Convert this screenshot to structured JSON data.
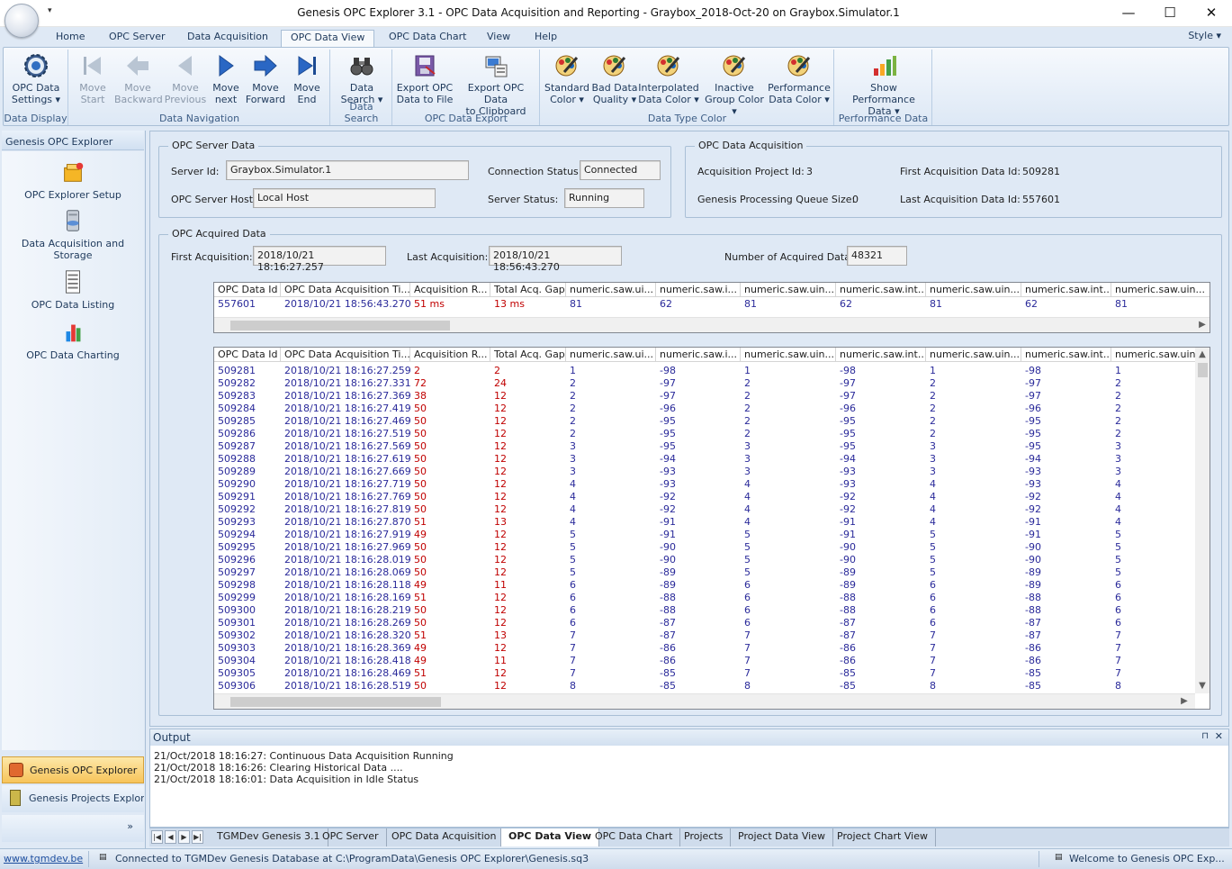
{
  "window": {
    "title": "Genesis OPC Explorer 3.1 - OPC Data Acquisition and Reporting - Graybox_2018-Oct-20 on Graybox.Simulator.1",
    "minimize": "—",
    "maximize": "☐",
    "close": "✕"
  },
  "ribbon_tabs": [
    "Home",
    "OPC Server",
    "Data Acquisition",
    "OPC Data View",
    "OPC Data Chart",
    "View",
    "Help"
  ],
  "active_tab": "OPC Data View",
  "style_menu": "Style",
  "ribbon": {
    "groups": {
      "data_display": "Data Display",
      "data_navigation": "Data Navigation",
      "data_search": "Data Search",
      "opc_data_export": "OPC Data Export",
      "data_type_color": "Data Type Color",
      "performance_data": "Performance Data"
    },
    "buttons": {
      "opc_data_settings": [
        "OPC Data",
        "Settings ▾"
      ],
      "move_start": [
        "Move",
        "Start"
      ],
      "move_backward": [
        "Move",
        "Backward"
      ],
      "move_previous": [
        "Move",
        "Previous"
      ],
      "move_next": [
        "Move",
        "next"
      ],
      "move_forward": [
        "Move",
        "Forward"
      ],
      "move_end": [
        "Move",
        "End"
      ],
      "data_search": [
        "Data",
        "Search ▾"
      ],
      "export_file": [
        "Export OPC",
        "Data to File"
      ],
      "export_clipboard": [
        "Export OPC Data",
        "to Clipboard"
      ],
      "standard_color": [
        "Standard",
        "Color ▾"
      ],
      "bad_data_quality": [
        "Bad Data",
        "Quality ▾"
      ],
      "interpolated_color": [
        "Interpolated",
        "Data Color ▾"
      ],
      "inactive_group_color": [
        "Inactive",
        "Group Color ▾"
      ],
      "performance_color": [
        "Performance",
        "Data Color ▾"
      ],
      "show_performance": [
        "Show Performance",
        "Data ▾"
      ]
    }
  },
  "nav": {
    "header": "Genesis OPC Explorer",
    "items": [
      {
        "label": "OPC Explorer Setup",
        "icon": "setup-icon"
      },
      {
        "label": "Data Acquisition and Storage",
        "icon": "database-icon"
      },
      {
        "label": "OPC Data Listing",
        "icon": "listing-icon"
      },
      {
        "label": "OPC Data Charting",
        "icon": "chart-icon"
      }
    ],
    "bottom": [
      "Genesis OPC Explorer",
      "Genesis Projects Explor..."
    ],
    "more": "»"
  },
  "server_data": {
    "title": "OPC Server Data",
    "server_id_label": "Server Id:",
    "server_id": "Graybox.Simulator.1",
    "host_label": "OPC Server Host:",
    "host": "Local Host",
    "conn_label": "Connection Status:",
    "conn": "Connected",
    "status_label": "Server Status:",
    "status": "Running"
  },
  "acquisition": {
    "title": "OPC Data Acquisition",
    "project_label": "Acquisition Project Id:",
    "project": "3",
    "queue_label": "Genesis Processing Queue Size:",
    "queue": "0",
    "first_label": "First Acquisition Data Id:",
    "first": "509281",
    "last_label": "Last Acquisition Data Id:",
    "last": "557601"
  },
  "acquired": {
    "title": "OPC Acquired Data",
    "first_label": "First Acquisition:",
    "first": "2018/10/21 18:16:27.257",
    "last_label": "Last Acquisition:",
    "last": "2018/10/21 18:56:43.270",
    "count_label": "Number of Acquired Data:",
    "count": "48321"
  },
  "columns": [
    "OPC Data Id",
    "OPC Data Acquisition Ti...",
    "Acquisition R...",
    "Total Acq. Gap",
    "numeric.saw.ui...",
    "numeric.saw.i...",
    "numeric.saw.uin...",
    "numeric.saw.int...",
    "numeric.saw.uin...",
    "numeric.saw.int...",
    "numeric.saw.uin..."
  ],
  "columns_lower": [
    "OPC Data Id",
    "OPC Data Acquisition Ti...",
    "Acquisition R...",
    "Total Acq. Gap",
    "numeric.saw.ui...",
    "numeric.saw.i...",
    "numeric.saw.uin...",
    "numeric.saw.int...",
    "numeric.saw.uin...",
    "numeric.saw.int...",
    "numeric.saw.uin.."
  ],
  "latest_row": [
    "557601",
    "2018/10/21 18:56:43.270",
    "51 ms",
    "13 ms",
    "81",
    "62",
    "81",
    "62",
    "81",
    "62",
    "81"
  ],
  "rows": [
    [
      "509281",
      "2018/10/21 18:16:27.259",
      "2",
      "2",
      "1",
      "-98",
      "1",
      "-98",
      "1",
      "-98",
      "1"
    ],
    [
      "509282",
      "2018/10/21 18:16:27.331",
      "72",
      "24",
      "2",
      "-97",
      "2",
      "-97",
      "2",
      "-97",
      "2"
    ],
    [
      "509283",
      "2018/10/21 18:16:27.369",
      "38",
      "12",
      "2",
      "-97",
      "2",
      "-97",
      "2",
      "-97",
      "2"
    ],
    [
      "509284",
      "2018/10/21 18:16:27.419",
      "50",
      "12",
      "2",
      "-96",
      "2",
      "-96",
      "2",
      "-96",
      "2"
    ],
    [
      "509285",
      "2018/10/21 18:16:27.469",
      "50",
      "12",
      "2",
      "-95",
      "2",
      "-95",
      "2",
      "-95",
      "2"
    ],
    [
      "509286",
      "2018/10/21 18:16:27.519",
      "50",
      "12",
      "2",
      "-95",
      "2",
      "-95",
      "2",
      "-95",
      "2"
    ],
    [
      "509287",
      "2018/10/21 18:16:27.569",
      "50",
      "12",
      "3",
      "-95",
      "3",
      "-95",
      "3",
      "-95",
      "3"
    ],
    [
      "509288",
      "2018/10/21 18:16:27.619",
      "50",
      "12",
      "3",
      "-94",
      "3",
      "-94",
      "3",
      "-94",
      "3"
    ],
    [
      "509289",
      "2018/10/21 18:16:27.669",
      "50",
      "12",
      "3",
      "-93",
      "3",
      "-93",
      "3",
      "-93",
      "3"
    ],
    [
      "509290",
      "2018/10/21 18:16:27.719",
      "50",
      "12",
      "4",
      "-93",
      "4",
      "-93",
      "4",
      "-93",
      "4"
    ],
    [
      "509291",
      "2018/10/21 18:16:27.769",
      "50",
      "12",
      "4",
      "-92",
      "4",
      "-92",
      "4",
      "-92",
      "4"
    ],
    [
      "509292",
      "2018/10/21 18:16:27.819",
      "50",
      "12",
      "4",
      "-92",
      "4",
      "-92",
      "4",
      "-92",
      "4"
    ],
    [
      "509293",
      "2018/10/21 18:16:27.870",
      "51",
      "13",
      "4",
      "-91",
      "4",
      "-91",
      "4",
      "-91",
      "4"
    ],
    [
      "509294",
      "2018/10/21 18:16:27.919",
      "49",
      "12",
      "5",
      "-91",
      "5",
      "-91",
      "5",
      "-91",
      "5"
    ],
    [
      "509295",
      "2018/10/21 18:16:27.969",
      "50",
      "12",
      "5",
      "-90",
      "5",
      "-90",
      "5",
      "-90",
      "5"
    ],
    [
      "509296",
      "2018/10/21 18:16:28.019",
      "50",
      "12",
      "5",
      "-90",
      "5",
      "-90",
      "5",
      "-90",
      "5"
    ],
    [
      "509297",
      "2018/10/21 18:16:28.069",
      "50",
      "12",
      "5",
      "-89",
      "5",
      "-89",
      "5",
      "-89",
      "5"
    ],
    [
      "509298",
      "2018/10/21 18:16:28.118",
      "49",
      "11",
      "6",
      "-89",
      "6",
      "-89",
      "6",
      "-89",
      "6"
    ],
    [
      "509299",
      "2018/10/21 18:16:28.169",
      "51",
      "12",
      "6",
      "-88",
      "6",
      "-88",
      "6",
      "-88",
      "6"
    ],
    [
      "509300",
      "2018/10/21 18:16:28.219",
      "50",
      "12",
      "6",
      "-88",
      "6",
      "-88",
      "6",
      "-88",
      "6"
    ],
    [
      "509301",
      "2018/10/21 18:16:28.269",
      "50",
      "12",
      "6",
      "-87",
      "6",
      "-87",
      "6",
      "-87",
      "6"
    ],
    [
      "509302",
      "2018/10/21 18:16:28.320",
      "51",
      "13",
      "7",
      "-87",
      "7",
      "-87",
      "7",
      "-87",
      "7"
    ],
    [
      "509303",
      "2018/10/21 18:16:28.369",
      "49",
      "12",
      "7",
      "-86",
      "7",
      "-86",
      "7",
      "-86",
      "7"
    ],
    [
      "509304",
      "2018/10/21 18:16:28.418",
      "49",
      "11",
      "7",
      "-86",
      "7",
      "-86",
      "7",
      "-86",
      "7"
    ],
    [
      "509305",
      "2018/10/21 18:16:28.469",
      "51",
      "12",
      "7",
      "-85",
      "7",
      "-85",
      "7",
      "-85",
      "7"
    ],
    [
      "509306",
      "2018/10/21 18:16:28.519",
      "50",
      "12",
      "8",
      "-85",
      "8",
      "-85",
      "8",
      "-85",
      "8"
    ]
  ],
  "output": {
    "title": "Output",
    "pin": "⊓",
    "close": "✕",
    "lines": [
      "21/Oct/2018 18:16:27: Continuous Data Acquisition Running",
      "21/Oct/2018 18:16:26: Clearing Historical Data ....",
      "21/Oct/2018 18:16:01: Data Acquisition in Idle Status"
    ]
  },
  "doc_tabs": [
    "TGMDev Genesis 3.1",
    "OPC Server",
    "OPC Data Acquisition",
    "OPC Data View",
    "OPC Data Chart",
    "Projects",
    "Project Data View",
    "Project Chart View"
  ],
  "active_doc_tab": "OPC Data View",
  "status": {
    "link": "www.tgmdev.be",
    "db": "Connected to TGMDev Genesis Database at C:\\ProgramData\\Genesis OPC Explorer\\Genesis.sq3",
    "welcome": "Welcome to Genesis OPC Exp..."
  },
  "colors": {
    "accent": "#1e395b",
    "value_blue": "#2a2a9a",
    "value_red": "#c00000",
    "nav_highlight": "#f7c45a"
  }
}
